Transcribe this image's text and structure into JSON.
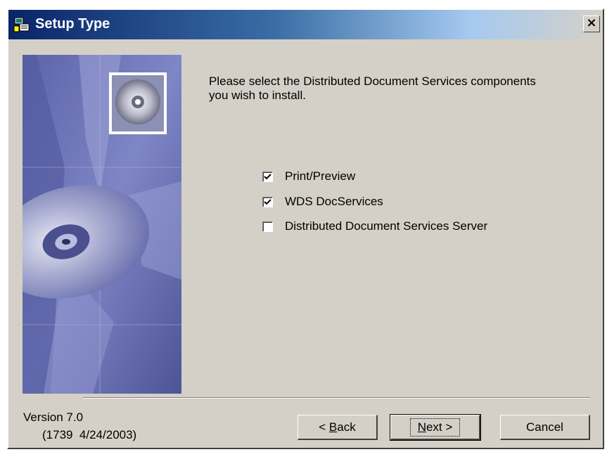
{
  "window": {
    "title": "Setup Type",
    "close_label": "×"
  },
  "main": {
    "prompt": "Please select the Distributed Document Services components you wish to install.",
    "options": [
      {
        "label": "Print/Preview",
        "checked": true
      },
      {
        "label": "WDS DocServices",
        "checked": true
      },
      {
        "label": "Distributed Document Services Server",
        "checked": false
      }
    ]
  },
  "footer": {
    "version": "Version 7.0",
    "build": "(1739  4/24/2003)",
    "back_pre": "< ",
    "back_acc": "B",
    "back_post": "ack",
    "next_acc": "N",
    "next_post": "ext >",
    "cancel_label": "Cancel"
  },
  "colors": {
    "title_bar_start": "#0a246a",
    "dialog_face": "#d4d0c8",
    "side_image_base": "#6f76b8"
  },
  "icons": {
    "app": "setup-app-icon",
    "side_image": "cd-disc-graphic",
    "check": "checkmark-icon"
  }
}
